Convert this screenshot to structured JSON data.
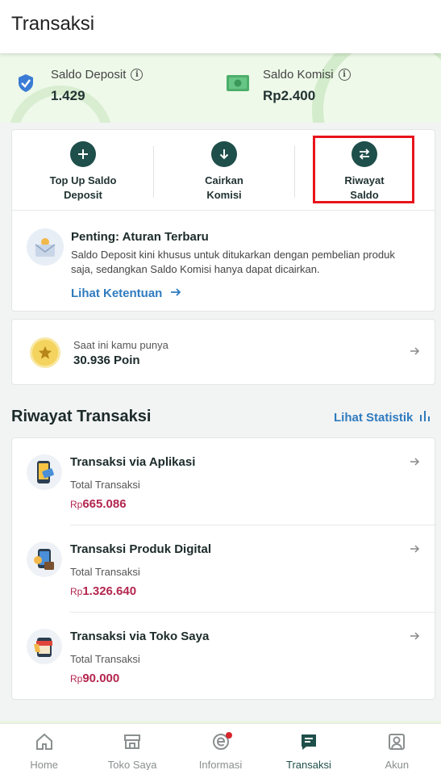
{
  "app_bar": {
    "title": "Transaksi"
  },
  "saldo": {
    "deposit": {
      "label": "Saldo Deposit",
      "value": "1.429",
      "icon": "shield-check-icon"
    },
    "komisi": {
      "label": "Saldo Komisi",
      "value": "Rp2.400",
      "icon": "money-icon"
    }
  },
  "actions": [
    {
      "label": "Top Up Saldo\nDeposit",
      "icon": "plus-icon"
    },
    {
      "label": "Cairkan\nKomisi",
      "icon": "arrow-down-icon"
    },
    {
      "label": "Riwayat\nSaldo",
      "icon": "swap-icon"
    }
  ],
  "notice": {
    "title": "Penting: Aturan Terbaru",
    "body": "Saldo Deposit kini khusus untuk ditukarkan dengan pembelian produk saja, sedangkan Saldo Komisi hanya dapat dicairkan.",
    "link": "Lihat Ketentuan"
  },
  "poin": {
    "subtitle": "Saat ini kamu punya",
    "value": "30.936 Poin"
  },
  "riwayat": {
    "title": "Riwayat Transaksi",
    "stat_link": "Lihat Statistik",
    "items": [
      {
        "title": "Transaksi via Aplikasi",
        "sub": "Total Transaksi",
        "currency": "Rp",
        "amount": "665.086",
        "icon": "phone-card-icon"
      },
      {
        "title": "Transaksi Produk Digital",
        "sub": "Total Transaksi",
        "currency": "Rp",
        "amount": "1.326.640",
        "icon": "digital-product-icon"
      },
      {
        "title": "Transaksi via Toko Saya",
        "sub": "Total Transaksi",
        "currency": "Rp",
        "amount": "90.000",
        "icon": "store-icon"
      }
    ]
  },
  "nav": [
    {
      "label": "Home",
      "icon": "home-icon"
    },
    {
      "label": "Toko Saya",
      "icon": "store-icon"
    },
    {
      "label": "Informasi",
      "icon": "info-e-icon"
    },
    {
      "label": "Transaksi",
      "icon": "receipt-icon",
      "active": true
    },
    {
      "label": "Akun",
      "icon": "account-icon"
    }
  ],
  "colors": {
    "primary": "#1f4f4a",
    "link": "#2f7bbf",
    "amount": "#b3264f",
    "highlight": "#e8141c",
    "band": "#eef9e9"
  }
}
